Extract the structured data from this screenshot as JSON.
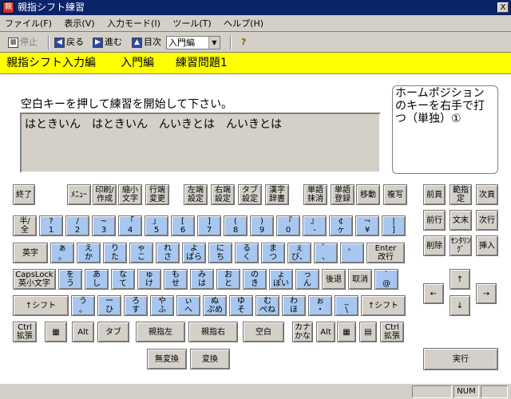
{
  "window": {
    "title": "親指シフト練習",
    "close": "X"
  },
  "menu": [
    {
      "label": "ファイル(F)"
    },
    {
      "label": "表示(V)"
    },
    {
      "label": "入力モード(I)"
    },
    {
      "label": "ツール(T)"
    },
    {
      "label": "ヘルプ(H)"
    }
  ],
  "toolbar": {
    "stop": "停止",
    "back": "戻る",
    "forward": "進む",
    "toc": "目次",
    "combo_value": "入門編",
    "help_icon": "?"
  },
  "header": {
    "text": "親指シフト入力編       入門編      練習問題1"
  },
  "instruction": "空白キーを押して練習を開始して下さい。",
  "drill_text": "はときいん　はときいん　んいきとは　んいきとは",
  "hint_text": "ホームポジションのキーを右手で打つ（単独）①",
  "function_keys": [
    {
      "id": "end",
      "label": "終了"
    },
    {
      "id": "menu",
      "label": "ﾒﾆｭｰ"
    },
    {
      "id": "print",
      "label": "印刷/\n作成"
    },
    {
      "id": "small",
      "label": "縮小\n文字"
    },
    {
      "id": "linechg",
      "label": "行端\n変更"
    },
    {
      "id": "left-set",
      "label": "左端\n設定"
    },
    {
      "id": "right-set",
      "label": "右端\n設定"
    },
    {
      "id": "tab-set",
      "label": "タブ\n設定"
    },
    {
      "id": "kanji-dict",
      "label": "漢字\n辞書"
    },
    {
      "id": "word-del",
      "label": "単語\n抹消"
    },
    {
      "id": "word-reg",
      "label": "単語\n登録"
    },
    {
      "id": "move",
      "label": "移動"
    },
    {
      "id": "copy",
      "label": "複写"
    }
  ],
  "rows": [
    [
      {
        "t": "半/\n全",
        "b": false
      },
      {
        "t": "?\n1",
        "b": true
      },
      {
        "t": "/\n2",
        "b": true
      },
      {
        "t": "~\n3",
        "b": true
      },
      {
        "t": "「\n4",
        "b": true
      },
      {
        "t": "」\n5",
        "b": true
      },
      {
        "t": "[\n6",
        "b": true
      },
      {
        "t": "]\n7",
        "b": true
      },
      {
        "t": "(\n8",
        "b": true
      },
      {
        "t": ")\n9",
        "b": true
      },
      {
        "t": "『\n0",
        "b": true
      },
      {
        "t": "』\n-",
        "b": true
      },
      {
        "t": "¢\nヶ",
        "b": true
      },
      {
        "t": "¬\n¥",
        "b": true
      },
      {
        "t": "|\n]",
        "b": true
      }
    ],
    [
      {
        "t": "英字",
        "b": false
      },
      {
        "t": "ぁ\n。",
        "b": true
      },
      {
        "t": "え\nか",
        "b": true
      },
      {
        "t": "り\nた",
        "b": true
      },
      {
        "t": "ゃ\nこ",
        "b": true
      },
      {
        "t": "れ\nさ",
        "b": true
      },
      {
        "t": "よ\nぱら",
        "b": true
      },
      {
        "t": "に\nち",
        "b": true
      },
      {
        "t": "る\nく",
        "b": true
      },
      {
        "t": "ま\nつ",
        "b": true
      },
      {
        "t": "ぇ\nぴ、",
        "b": true
      },
      {
        "t": "゛\n、",
        "b": true
      },
      {
        "t": "゜\n",
        "b": true
      },
      {
        "t": "Enter\n改行",
        "b": false
      }
    ],
    [
      {
        "t": "CapsLock\n英小文字",
        "b": false
      },
      {
        "t": "を\nう",
        "b": true
      },
      {
        "t": "あ\nし",
        "b": true
      },
      {
        "t": "な\nて",
        "b": true
      },
      {
        "t": "ゅ\nけ",
        "b": true
      },
      {
        "t": "も\nせ",
        "b": true
      },
      {
        "t": "み\nは",
        "b": true
      },
      {
        "t": "お\nと",
        "b": true
      },
      {
        "t": "の\nき",
        "b": true
      },
      {
        "t": "ょ\nぽい",
        "b": true
      },
      {
        "t": "っ\nん",
        "b": true
      },
      {
        "t": "後退",
        "b": false
      },
      {
        "t": "取消",
        "b": false
      },
      {
        "t": "`\n@",
        "b": true
      }
    ],
    [
      {
        "t": "↑シフト",
        "b": false
      },
      {
        "t": "う\n。",
        "b": true
      },
      {
        "t": "ー\nひ",
        "b": true
      },
      {
        "t": "ろ\nす",
        "b": true
      },
      {
        "t": "や\nふ",
        "b": true
      },
      {
        "t": "ぃ\nへ",
        "b": true
      },
      {
        "t": "ぬ\nぷめ",
        "b": true
      },
      {
        "t": "ゆ\nそ",
        "b": true
      },
      {
        "t": "む\nぺね",
        "b": true
      },
      {
        "t": "わ\nほ",
        "b": true
      },
      {
        "t": "ぉ\n・",
        "b": true
      },
      {
        "t": "_\n\\",
        "b": true
      },
      {
        "t": "↑シフト",
        "b": false
      }
    ],
    [
      {
        "t": "Ctrl\n拡張",
        "b": false
      },
      {
        "t": "▦",
        "b": false
      },
      {
        "t": "Alt",
        "b": false
      },
      {
        "t": "タブ",
        "b": false
      },
      {
        "t": "親指左",
        "b": false
      },
      {
        "t": "親指右",
        "b": false
      },
      {
        "t": "空白",
        "b": false
      },
      {
        "t": "カナ\nかな",
        "b": false
      },
      {
        "t": "Alt",
        "b": false
      },
      {
        "t": "▦",
        "b": false
      },
      {
        "t": "▤",
        "b": false
      },
      {
        "t": "Ctrl\n拡張",
        "b": false
      }
    ],
    [
      {
        "t": "無変換",
        "b": false
      },
      {
        "t": "変換",
        "b": false
      }
    ]
  ],
  "nav_keys": [
    {
      "id": "prev-page",
      "label": "前頁"
    },
    {
      "id": "range",
      "label": "範指定"
    },
    {
      "id": "next-page",
      "label": "次頁"
    },
    {
      "id": "prev-line",
      "label": "前行"
    },
    {
      "id": "doc-end",
      "label": "文末"
    },
    {
      "id": "next-line",
      "label": "次行"
    },
    {
      "id": "delete",
      "label": "削除"
    },
    {
      "id": "center",
      "label": "ｾﾝﾀﾘﾝｸﾞ"
    },
    {
      "id": "insert",
      "label": "挿入"
    },
    {
      "id": "up",
      "label": "↑"
    },
    {
      "id": "left",
      "label": "←"
    },
    {
      "id": "right",
      "label": "→"
    },
    {
      "id": "down",
      "label": "↓"
    },
    {
      "id": "execute",
      "label": "実行"
    }
  ],
  "status": {
    "num": "NUM"
  }
}
